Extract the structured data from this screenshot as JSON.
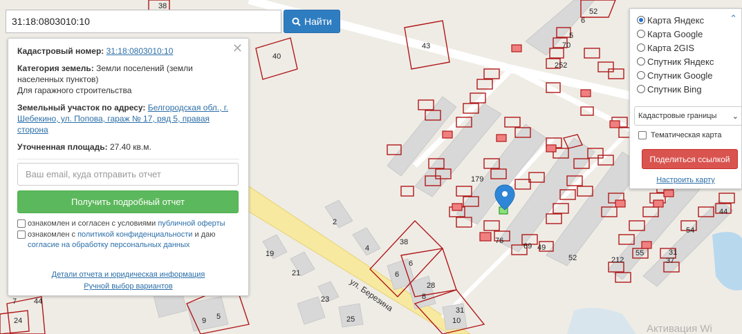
{
  "search": {
    "value": "31:18:0803010:10",
    "button_label": "Найти"
  },
  "info": {
    "cadastral_label": "Кадастровый номер:",
    "cadastral_value": "31:18:0803010:10",
    "category_label": "Категория земель:",
    "category_value": "Земли поселений (земли населенных пунктов)",
    "usage": "Для гаражного строительства",
    "address_label": "Земельный участок по адресу:",
    "address_value": "Белгородская обл., г. Шебекино, ул. Попова, гараж № 17, ряд 5, правая сторона",
    "area_label": "Уточненная площадь:",
    "area_value": "27.40 кв.м.",
    "email_placeholder": "Ваш email, куда отправить отчет",
    "report_button": "Получить подробный отчет",
    "offer_prefix": "ознакомлен и согласен с условиями",
    "offer_link": "публичной оферты",
    "privacy_prefix": "ознакомлен с",
    "privacy_link": "политикой конфиденциальности",
    "privacy_suffix": "и даю",
    "consent_link": "согласие на обработку персональных данных",
    "details_link": "Детали отчета и юридическая информация",
    "manual_link": "Ручной выбор вариантов"
  },
  "layers": {
    "options": [
      "Карта Яндекс",
      "Карта Google",
      "Карта 2GIS",
      "Спутник Яндекс",
      "Спутник Google",
      "Спутник Bing"
    ],
    "selected": "Карта Яндекс",
    "select_value": "Кадастровые границы",
    "thematic": "Тематическая карта",
    "share_button": "Поделиться ссылкой",
    "setup_link": "Настроить карту"
  },
  "map": {
    "street": "ул. Березина",
    "labels": [
      "38",
      "40",
      "43",
      "52",
      "6",
      "5",
      "70",
      "252",
      "179",
      "76",
      "69",
      "49",
      "52",
      "212",
      "55",
      "37",
      "31",
      "54",
      "44",
      "2",
      "4",
      "19",
      "21",
      "23",
      "25",
      "9",
      "5",
      "38",
      "6",
      "6",
      "28",
      "8",
      "31",
      "10",
      "7",
      "44",
      "24"
    ]
  },
  "watermark": "Активация Wi"
}
